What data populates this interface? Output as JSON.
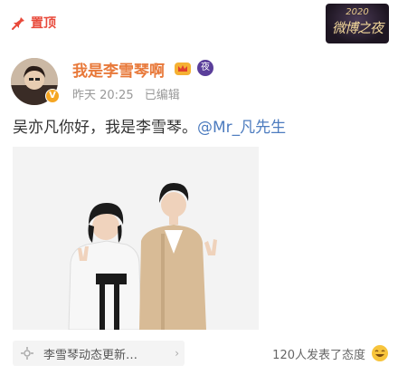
{
  "pin": {
    "label": "置顶",
    "icon": "pin-icon",
    "color": "#e8493a"
  },
  "event_badge": {
    "year": "2020",
    "name": "微博之夜"
  },
  "post": {
    "username": "我是李雪琴啊",
    "username_color": "#e8793a",
    "vip_icon": "crown-vip-icon",
    "level_badge": "夜",
    "verify_icon": "verified-icon",
    "time": "昨天 20:25",
    "edited": "已编辑",
    "text": "吴亦凡你好，我是李雪琴。",
    "mention": "@Mr_凡先生",
    "mention_color": "#4d7cbf"
  },
  "topic": {
    "label": "李雪琴动态更新…",
    "icon": "topic-icon",
    "arrow": "›"
  },
  "reaction": {
    "label": "120人发表了态度",
    "icon": "smile-emoji-icon"
  }
}
